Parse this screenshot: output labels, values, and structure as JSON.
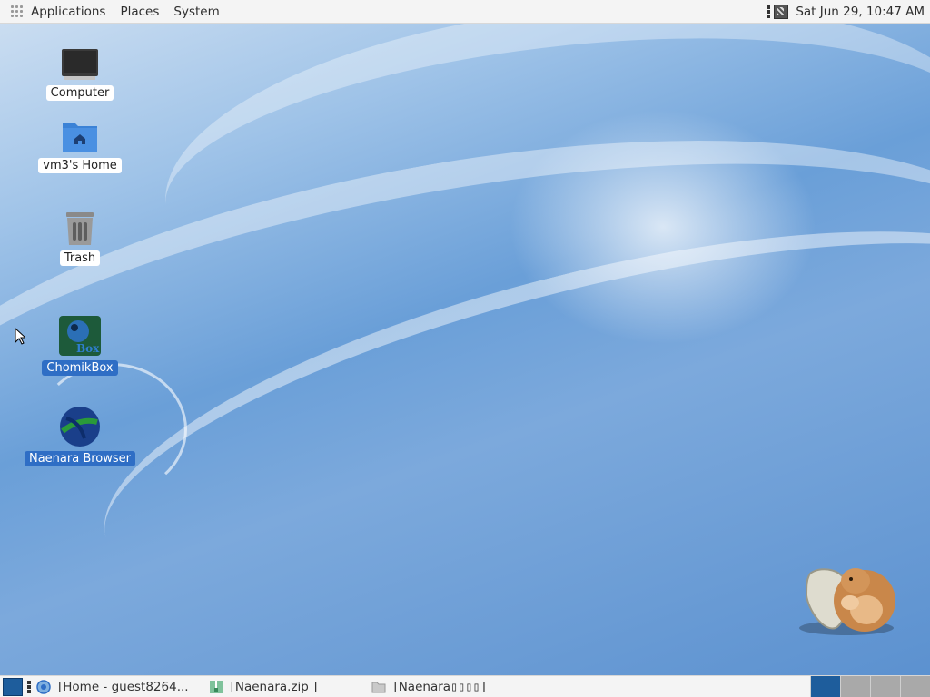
{
  "top_panel": {
    "menus": [
      "Applications",
      "Places",
      "System"
    ],
    "clock": "Sat Jun 29, 10:47 AM",
    "icons": [
      "apps-grid-icon",
      "network-icon"
    ]
  },
  "desktop": {
    "icons": [
      {
        "label": "Computer",
        "icon": "computer-icon",
        "selected": false
      },
      {
        "label": "vm3's Home",
        "icon": "home-folder-icon",
        "selected": false
      },
      {
        "label": "Trash",
        "icon": "trash-icon",
        "selected": false
      },
      {
        "label": "ChomikBox",
        "icon": "chomikbox-icon",
        "selected": true
      },
      {
        "label": "Naenara Browser",
        "icon": "naenara-browser-icon",
        "selected": true
      }
    ],
    "mascot": "hamster-in-shell-image"
  },
  "bottom_panel": {
    "tasks": [
      {
        "label": "[Home - guest8264...",
        "icon": "browser-icon"
      },
      {
        "label": "[Naenara.zip ]",
        "icon": "archive-icon"
      },
      {
        "label": "[Naenara ",
        "icon": "folder-icon",
        "suffix": "▯▯▯▯]"
      }
    ],
    "workspaces": {
      "count": 4,
      "active": 1
    }
  },
  "colors": {
    "panel": "#f4f4f4",
    "selection": "#2f6ec5",
    "active_workspace": "#1e5d9c"
  }
}
